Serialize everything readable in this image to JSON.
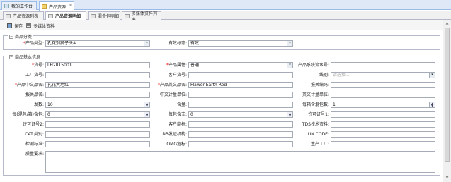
{
  "top_tabs": [
    {
      "label": "我的工作台"
    },
    {
      "label": "产品资源"
    }
  ],
  "sub_tabs": [
    {
      "label": "产品资源列表"
    },
    {
      "label": "产品资源明细"
    },
    {
      "label": "混合包明细"
    },
    {
      "label": "多媒体资料列表"
    }
  ],
  "toolbar": {
    "save_label": "保存",
    "media_label": "多媒体资料"
  },
  "section_category": {
    "title": "商品分类",
    "product_type_label": "产品类型:",
    "product_type_value": "孔花别狮子头A",
    "valid_flag_label": "有效标志:",
    "valid_flag_value": "有效"
  },
  "section_basic": {
    "title": "商品基本信息",
    "fields": {
      "goods_no": {
        "label": "货号:",
        "value": "LH2015001"
      },
      "product_attr": {
        "label": "产品属性:",
        "value": "普通"
      },
      "product_serial": {
        "label": "产品系统流水号:",
        "value": ""
      },
      "factory_no": {
        "label": "工厂货号:",
        "value": ""
      },
      "customer_no": {
        "label": "客户货号:",
        "value": ""
      },
      "line": {
        "label": "线别:",
        "value": "",
        "placeholder": "请选择..."
      },
      "cn_name": {
        "label": "产品中文品名:",
        "value": "孔花大地红"
      },
      "en_name": {
        "label": "产品英文品名:",
        "value": "Flawer Earth Red"
      },
      "customs_code": {
        "label": "报关编码:",
        "value": ""
      },
      "customs_name": {
        "label": "报关品名:",
        "value": ""
      },
      "cn_unit": {
        "label": "中文计量单位:",
        "value": ""
      },
      "en_unit": {
        "label": "英文计量单位:",
        "value": ""
      },
      "shots": {
        "label": "发数:",
        "value": "10"
      },
      "content": {
        "label": "含量:",
        "value": ""
      },
      "box_qty": {
        "label": "每箱含混包数:",
        "value": "1"
      },
      "per_pack": {
        "label": "每(混包/箱)含包:",
        "value": "0"
      },
      "per_bag": {
        "label": "每包含支:",
        "value": "0"
      },
      "license1": {
        "label": "许可证号1:",
        "value": ""
      },
      "license2": {
        "label": "许可证号2:",
        "value": ""
      },
      "customer_mark": {
        "label": "客户商标:",
        "value": ""
      },
      "tds": {
        "label": "TDS技术资料:",
        "value": ""
      },
      "cat": {
        "label": "CAT.类别:",
        "value": ""
      },
      "nb": {
        "label": "NB发证机构:",
        "value": ""
      },
      "un_code": {
        "label": "UN CODE:",
        "value": ""
      },
      "test_std": {
        "label": "检测标准:",
        "value": ""
      },
      "omg": {
        "label": "OMG危标:",
        "value": ""
      },
      "factory": {
        "label": "生产工厂:",
        "value": ""
      },
      "quality": {
        "label": "质量要求:",
        "value": ""
      }
    }
  }
}
